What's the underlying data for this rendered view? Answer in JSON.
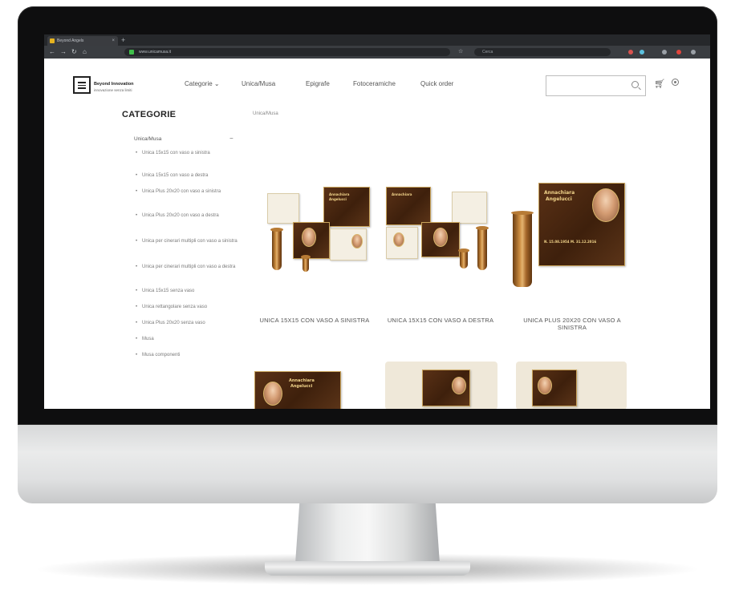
{
  "browser": {
    "tab_title": "Beyond Angels",
    "tab_close": "×",
    "new_tab": "+",
    "url": "www.unicamusa.it",
    "search_placeholder": "Cerca"
  },
  "site": {
    "brand": "Beyond Innovation",
    "tagline": "innovazione senza limiti"
  },
  "nav": {
    "items": [
      "Categorie ⌄",
      "Unica/Musa",
      "Epigrafe",
      "Fotoceramiche",
      "Quick order"
    ]
  },
  "header_icons": {
    "cart": "cart-icon",
    "user": "user-icon",
    "search": "search-icon"
  },
  "sidebar": {
    "title": "CATEGORIE",
    "group_label": "Unica/Musa",
    "collapse": "−",
    "items": [
      "Unica 15x15 con vaso a sinistra",
      "Unica 15x15 con vaso a destra",
      "Unica Plus 20x20 con vaso a sinistra",
      "Unica Plus 20x20 con vaso a destra",
      "Unica per cinerari multipli con vaso a sinistra",
      "Unica per cinerari multipli con vaso a destra",
      "Unica 15x15 senza vaso",
      "Unica rettangolare senza vaso",
      "Unica Plus 20x20 senza vaso",
      "Musa",
      "Musa componenti"
    ]
  },
  "breadcrumb": "Unica/Musa",
  "products": [
    {
      "title": "UNICA 15X15 CON VASO A SINISTRA"
    },
    {
      "title": "UNICA 15X15 CON VASO A DESTRA"
    },
    {
      "title": "UNICA PLUS 20X20 CON VASO A SINISTRA"
    }
  ],
  "plaque_text": {
    "name1": "Annachiara",
    "name2": "Angelucci",
    "dates": "N. 15.08.1954 M. 31.12.2016"
  },
  "colors": {
    "bronze": "#4a2712",
    "gold": "#d8b56a",
    "chin": "#dfe0e1"
  }
}
